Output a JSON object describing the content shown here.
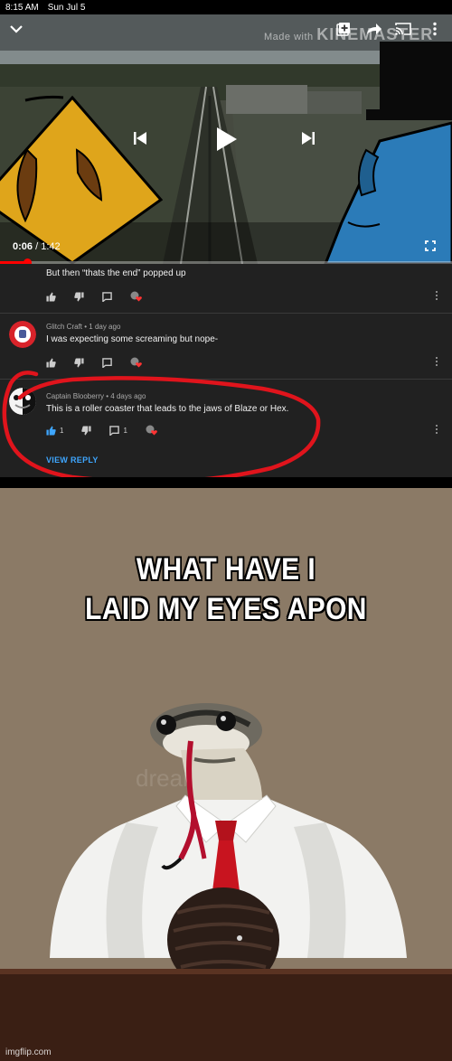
{
  "status_bar": {
    "time": "8:15 AM",
    "date": "Sun Jul 5"
  },
  "player": {
    "watermark_prefix": "Made with",
    "watermark_brand": "KINEMASTER",
    "current_time": "0:06",
    "duration": "/ 1:42",
    "progress_fraction": 0.06,
    "icons": [
      "collapse-icon",
      "add-to-playlist-icon",
      "share-icon",
      "cast-icon",
      "more-icon",
      "previous-icon",
      "play-icon",
      "next-icon",
      "fullscreen-icon"
    ]
  },
  "comments": [
    {
      "text": "But then “thats the end” popped up"
    },
    {
      "author": "Glitch Craft",
      "age": "1 day ago",
      "text": "I was expecting some screaming but nope-"
    },
    {
      "author": "Captain Blooberry",
      "age": "4 days ago",
      "text": "This is a roller coaster that leads to the jaws of Blaze or Hex.",
      "likes": "1",
      "replies": "1",
      "view_reply": "VIEW REPLY"
    }
  ],
  "meme": {
    "caption_line1": "WHAT HAVE I",
    "caption_line2": "LAID MY EYES APON",
    "photo_watermark": "dreamstime"
  },
  "site_watermark": "imgflip.com",
  "colors": {
    "annotation_red": "#e0141c",
    "link_blue": "#3ea6ff",
    "comment_bg": "#212121",
    "photo_bg": "#8b7a66"
  }
}
